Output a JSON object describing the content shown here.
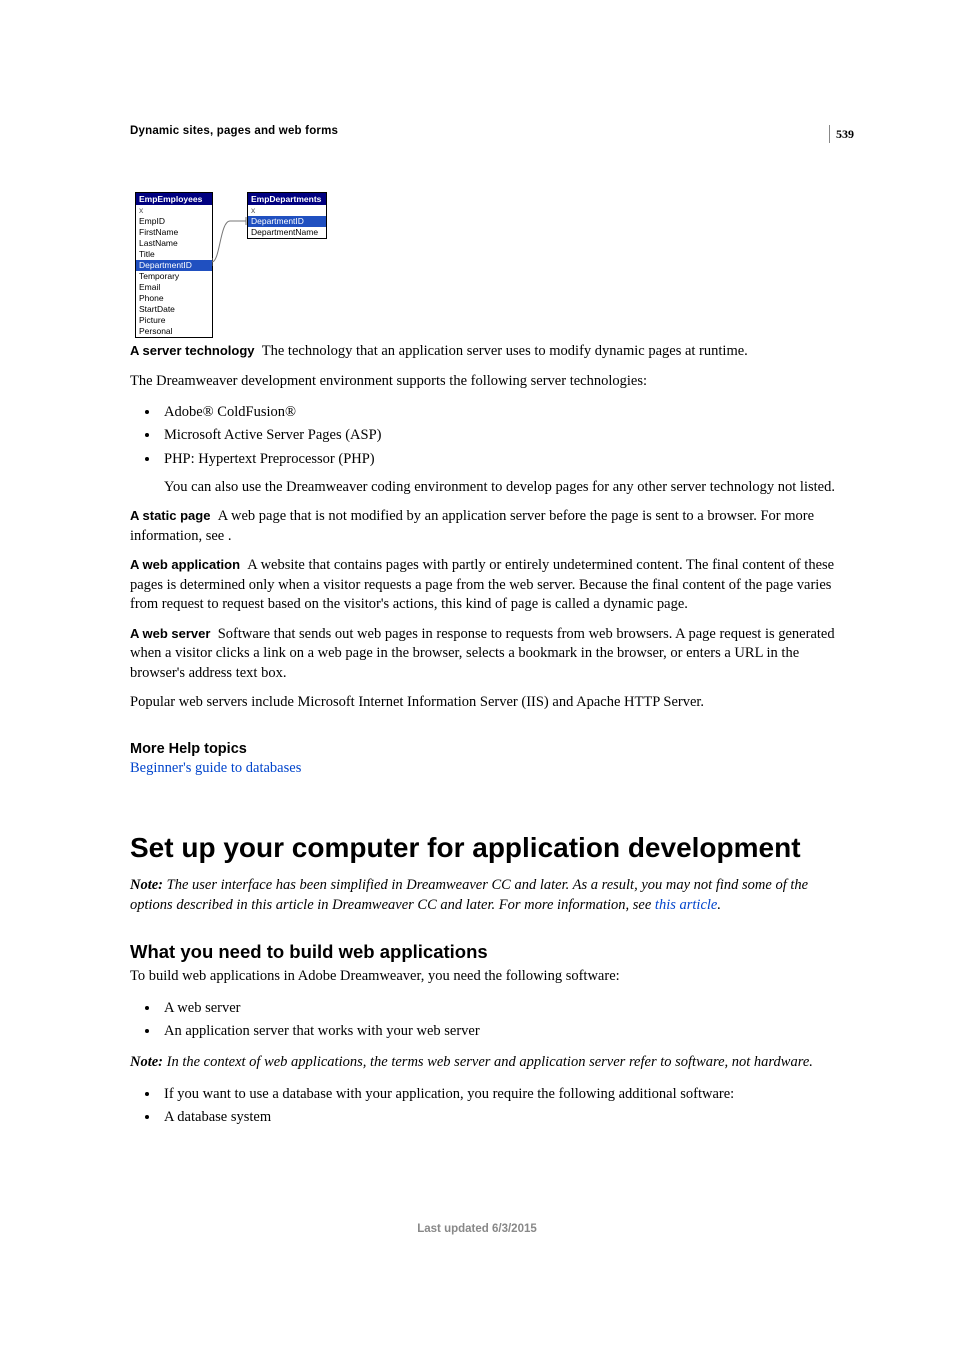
{
  "pageNumber": "539",
  "sectionHeader": "Dynamic sites, pages and web forms",
  "diagram": {
    "table1": {
      "header": "EmpEmployees",
      "rows": [
        "x",
        "EmpID",
        "FirstName",
        "LastName",
        "Title",
        "DepartmentID",
        "Temporary",
        "Email",
        "Phone",
        "StartDate",
        "Picture",
        "Personal"
      ],
      "highlight": "DepartmentID"
    },
    "table2": {
      "header": "EmpDepartments",
      "rows": [
        "x",
        "DepartmentID",
        "DepartmentName"
      ],
      "highlight": "DepartmentID"
    }
  },
  "defs": {
    "serverTech": {
      "term": "A server technology",
      "text": "The technology that an application server uses to modify dynamic pages at runtime."
    },
    "supportLine": "The Dreamweaver development environment supports the following server technologies:",
    "techList": [
      "Adobe® ColdFusion®",
      "Microsoft Active Server Pages (ASP)",
      "PHP: Hypertext Preprocessor (PHP)"
    ],
    "codingEnv": "You can also use the Dreamweaver coding environment to develop pages for any other server technology not listed.",
    "staticPage": {
      "term": "A static page",
      "text": "A web page that is not modified by an application server before the page is sent to a browser. For more information, see ."
    },
    "webApp": {
      "term": "A web application",
      "text": "A website that contains pages with partly or entirely undetermined content. The final content of these pages is determined only when a visitor requests a page from the web server. Because the final content of the page varies from request to request based on the visitor's actions, this kind of page is called a dynamic page."
    },
    "webServer": {
      "term": "A web server",
      "text": "Software that sends out web pages in response to requests from web browsers. A page request is generated when a visitor clicks a link on a web page in the browser, selects a bookmark in the browser, or enters a URL in the browser's address text box."
    },
    "popularServers": "Popular web servers include Microsoft Internet Information Server (IIS) and Apache HTTP Server."
  },
  "helpTopics": {
    "heading": "More Help topics",
    "link": "Beginner's guide to databases"
  },
  "mainHeading": "Set up your computer for application development",
  "noteTop": {
    "label": "Note: ",
    "text": "The user interface has been simplified in Dreamweaver CC and later. As a result, you may not find some of the options described in this article in Dreamweaver CC and later. For more information, see ",
    "link": "this article",
    "after": "."
  },
  "subHeading": "What you need to build web applications",
  "buildIntro": "To build web applications in Adobe Dreamweaver, you need the following software:",
  "buildList1": [
    "A web server",
    "An application server that works with your web server"
  ],
  "noteContext": {
    "label": "Note: ",
    "text": "In the context of web applications, the terms web server and application server refer to software, not hardware."
  },
  "buildList2": [
    "If you want to use a database with your application, you require the following additional software:",
    "A database system"
  ],
  "footer": "Last updated 6/3/2015"
}
